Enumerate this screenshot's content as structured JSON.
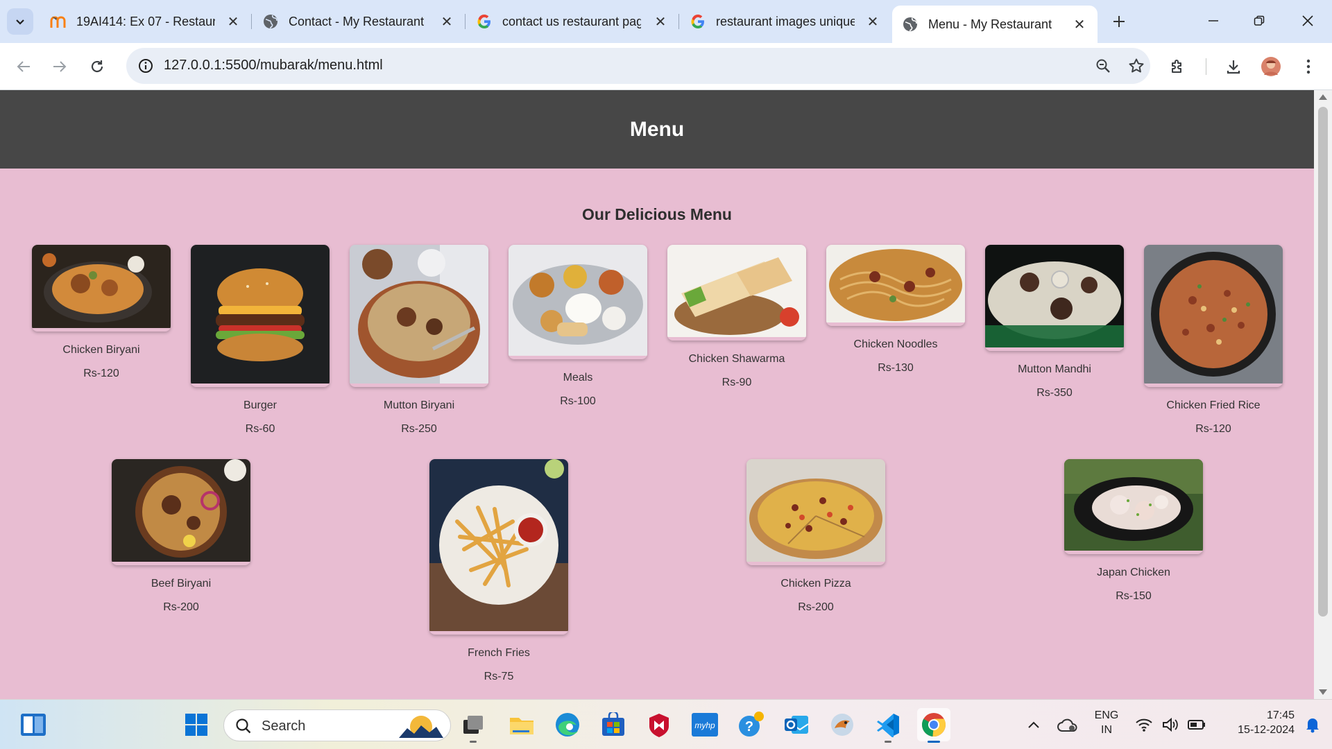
{
  "browser": {
    "tabs": [
      {
        "title": "19AI414: Ex 07 - Restaura",
        "icon": "moodle-icon",
        "active": false
      },
      {
        "title": "Contact - My Restaurant",
        "icon": "globe-icon",
        "active": false
      },
      {
        "title": "contact us restaurant pag",
        "icon": "google-icon",
        "active": false
      },
      {
        "title": "restaurant images unique",
        "icon": "google-icon",
        "active": false
      },
      {
        "title": "Menu - My Restaurant",
        "icon": "globe-icon",
        "active": true
      }
    ],
    "url": "127.0.0.1:5500/mubarak/menu.html"
  },
  "page": {
    "header_title": "Menu",
    "section_title": "Our Delicious Menu",
    "items": [
      {
        "name": "Chicken Biryani",
        "price": "Rs-120"
      },
      {
        "name": "Burger",
        "price": "Rs-60"
      },
      {
        "name": "Mutton Biryani",
        "price": "Rs-250"
      },
      {
        "name": "Meals",
        "price": "Rs-100"
      },
      {
        "name": "Chicken Shawarma",
        "price": "Rs-90"
      },
      {
        "name": "Chicken Noodles",
        "price": "Rs-130"
      },
      {
        "name": "Mutton Mandhi",
        "price": "Rs-350"
      },
      {
        "name": "Chicken Fried Rice",
        "price": "Rs-120"
      },
      {
        "name": "Beef Biryani",
        "price": "Rs-200"
      },
      {
        "name": "French Fries",
        "price": "Rs-75"
      },
      {
        "name": "Chicken Pizza",
        "price": "Rs-200"
      },
      {
        "name": "Japan Chicken",
        "price": "Rs-150"
      }
    ]
  },
  "taskbar": {
    "search_label": "Search",
    "language": "ENG",
    "region": "IN",
    "time": "17:45",
    "date": "15-12-2024"
  },
  "colors": {
    "page_background": "#e8bdd2",
    "header_background": "#474747",
    "tabstrip_background": "#dae6f9"
  }
}
